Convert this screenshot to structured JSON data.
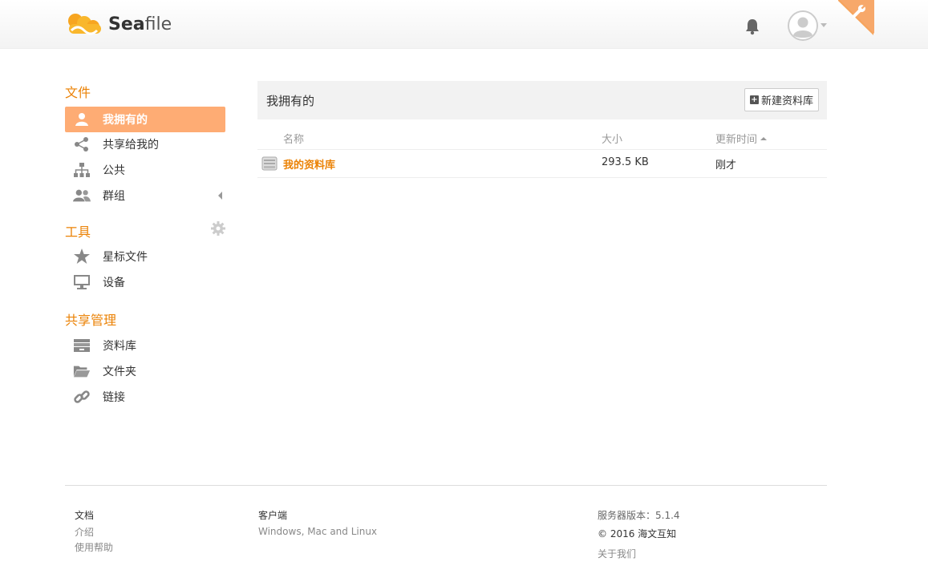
{
  "app": {
    "name_prefix": "Sea",
    "name_suffix": "file"
  },
  "sidebar": {
    "files_heading": "文件",
    "files_items": [
      {
        "label": "我拥有的",
        "icon": "user-icon",
        "active": true
      },
      {
        "label": "共享给我的",
        "icon": "share-icon"
      },
      {
        "label": "公共",
        "icon": "org-icon"
      },
      {
        "label": "群组",
        "icon": "group-icon"
      }
    ],
    "tools_heading": "工具",
    "tools_items": [
      {
        "label": "星标文件",
        "icon": "star-icon"
      },
      {
        "label": "设备",
        "icon": "monitor-icon"
      }
    ],
    "share_heading": "共享管理",
    "share_items": [
      {
        "label": "资料库",
        "icon": "library-icon"
      },
      {
        "label": "文件夹",
        "icon": "folder-icon"
      },
      {
        "label": "链接",
        "icon": "link-icon"
      }
    ]
  },
  "main": {
    "title": "我拥有的",
    "new_button": "新建资料库",
    "columns": {
      "name": "名称",
      "size": "大小",
      "updated": "更新时间"
    },
    "rows": [
      {
        "name": "我的资料库",
        "size": "293.5 KB",
        "updated": "刚才"
      }
    ]
  },
  "footer": {
    "docs_title": "文档",
    "docs_links": [
      "介绍",
      "使用帮助"
    ],
    "client_title": "客户端",
    "client_text": "Windows, Mac and Linux",
    "server_version": "服务器版本：5.1.4",
    "copyright": "© 2016 海文互知",
    "about": "关于我们"
  },
  "colors": {
    "accent": "#eb8205",
    "active_bg": "#feac74"
  }
}
